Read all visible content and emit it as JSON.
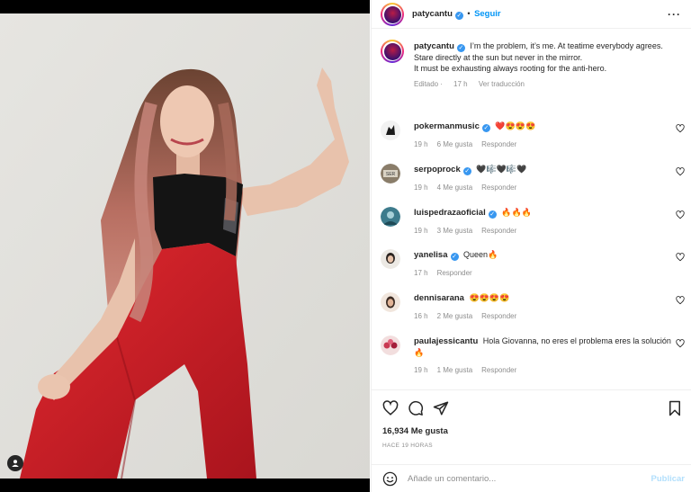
{
  "post": {
    "username": "patycantu",
    "follow_label": "Seguir",
    "caption": "I’m the problem, it’s me. At teatime everybody agrees.\nStare directly at the sun but never in the mirror.\nIt must be exhausting always rooting for the anti-hero.",
    "edited_label": "Editado",
    "time": "17 h",
    "translate_label": "Ver traducción"
  },
  "comments": [
    {
      "username": "pokermanmusic",
      "verified": true,
      "text": "❤️😍😍😍",
      "time": "19 h",
      "likes": "6 Me gusta",
      "reply": "Responder"
    },
    {
      "username": "serpoprock",
      "verified": true,
      "text": "🖤🎼🖤🎼🖤",
      "time": "19 h",
      "likes": "4 Me gusta",
      "reply": "Responder"
    },
    {
      "username": "luispedrazaoficial",
      "verified": true,
      "text": "🔥🔥🔥",
      "time": "19 h",
      "likes": "3 Me gusta",
      "reply": "Responder"
    },
    {
      "username": "yanelisa",
      "verified": true,
      "text": "Queen🔥",
      "time": "17 h",
      "likes": "",
      "reply": "Responder"
    },
    {
      "username": "dennisarana",
      "verified": false,
      "text": "😍😍😍😍",
      "time": "16 h",
      "likes": "2 Me gusta",
      "reply": "Responder"
    },
    {
      "username": "paulajessicantu",
      "verified": false,
      "text": "Hola Giovanna, no eres el problema eres la solución 🔥",
      "time": "19 h",
      "likes": "1 Me gusta",
      "reply": "Responder"
    }
  ],
  "actions": {
    "likes_count": "16,934 Me gusta",
    "time_ago": "HACE 19 HORAS"
  },
  "comment_box": {
    "placeholder": "Añade un comentario...",
    "publish_label": "Publicar"
  },
  "colors": {
    "accent": "#0095f6",
    "verified": "#3897f0",
    "publish_disabled": "#b2dffc",
    "outfit_red": "#d0202b"
  },
  "icons": [
    "user-tag-icon",
    "more-options-icon",
    "verified-icon",
    "heart-icon",
    "comment-icon",
    "share-icon",
    "bookmark-icon",
    "emoji-icon"
  ]
}
